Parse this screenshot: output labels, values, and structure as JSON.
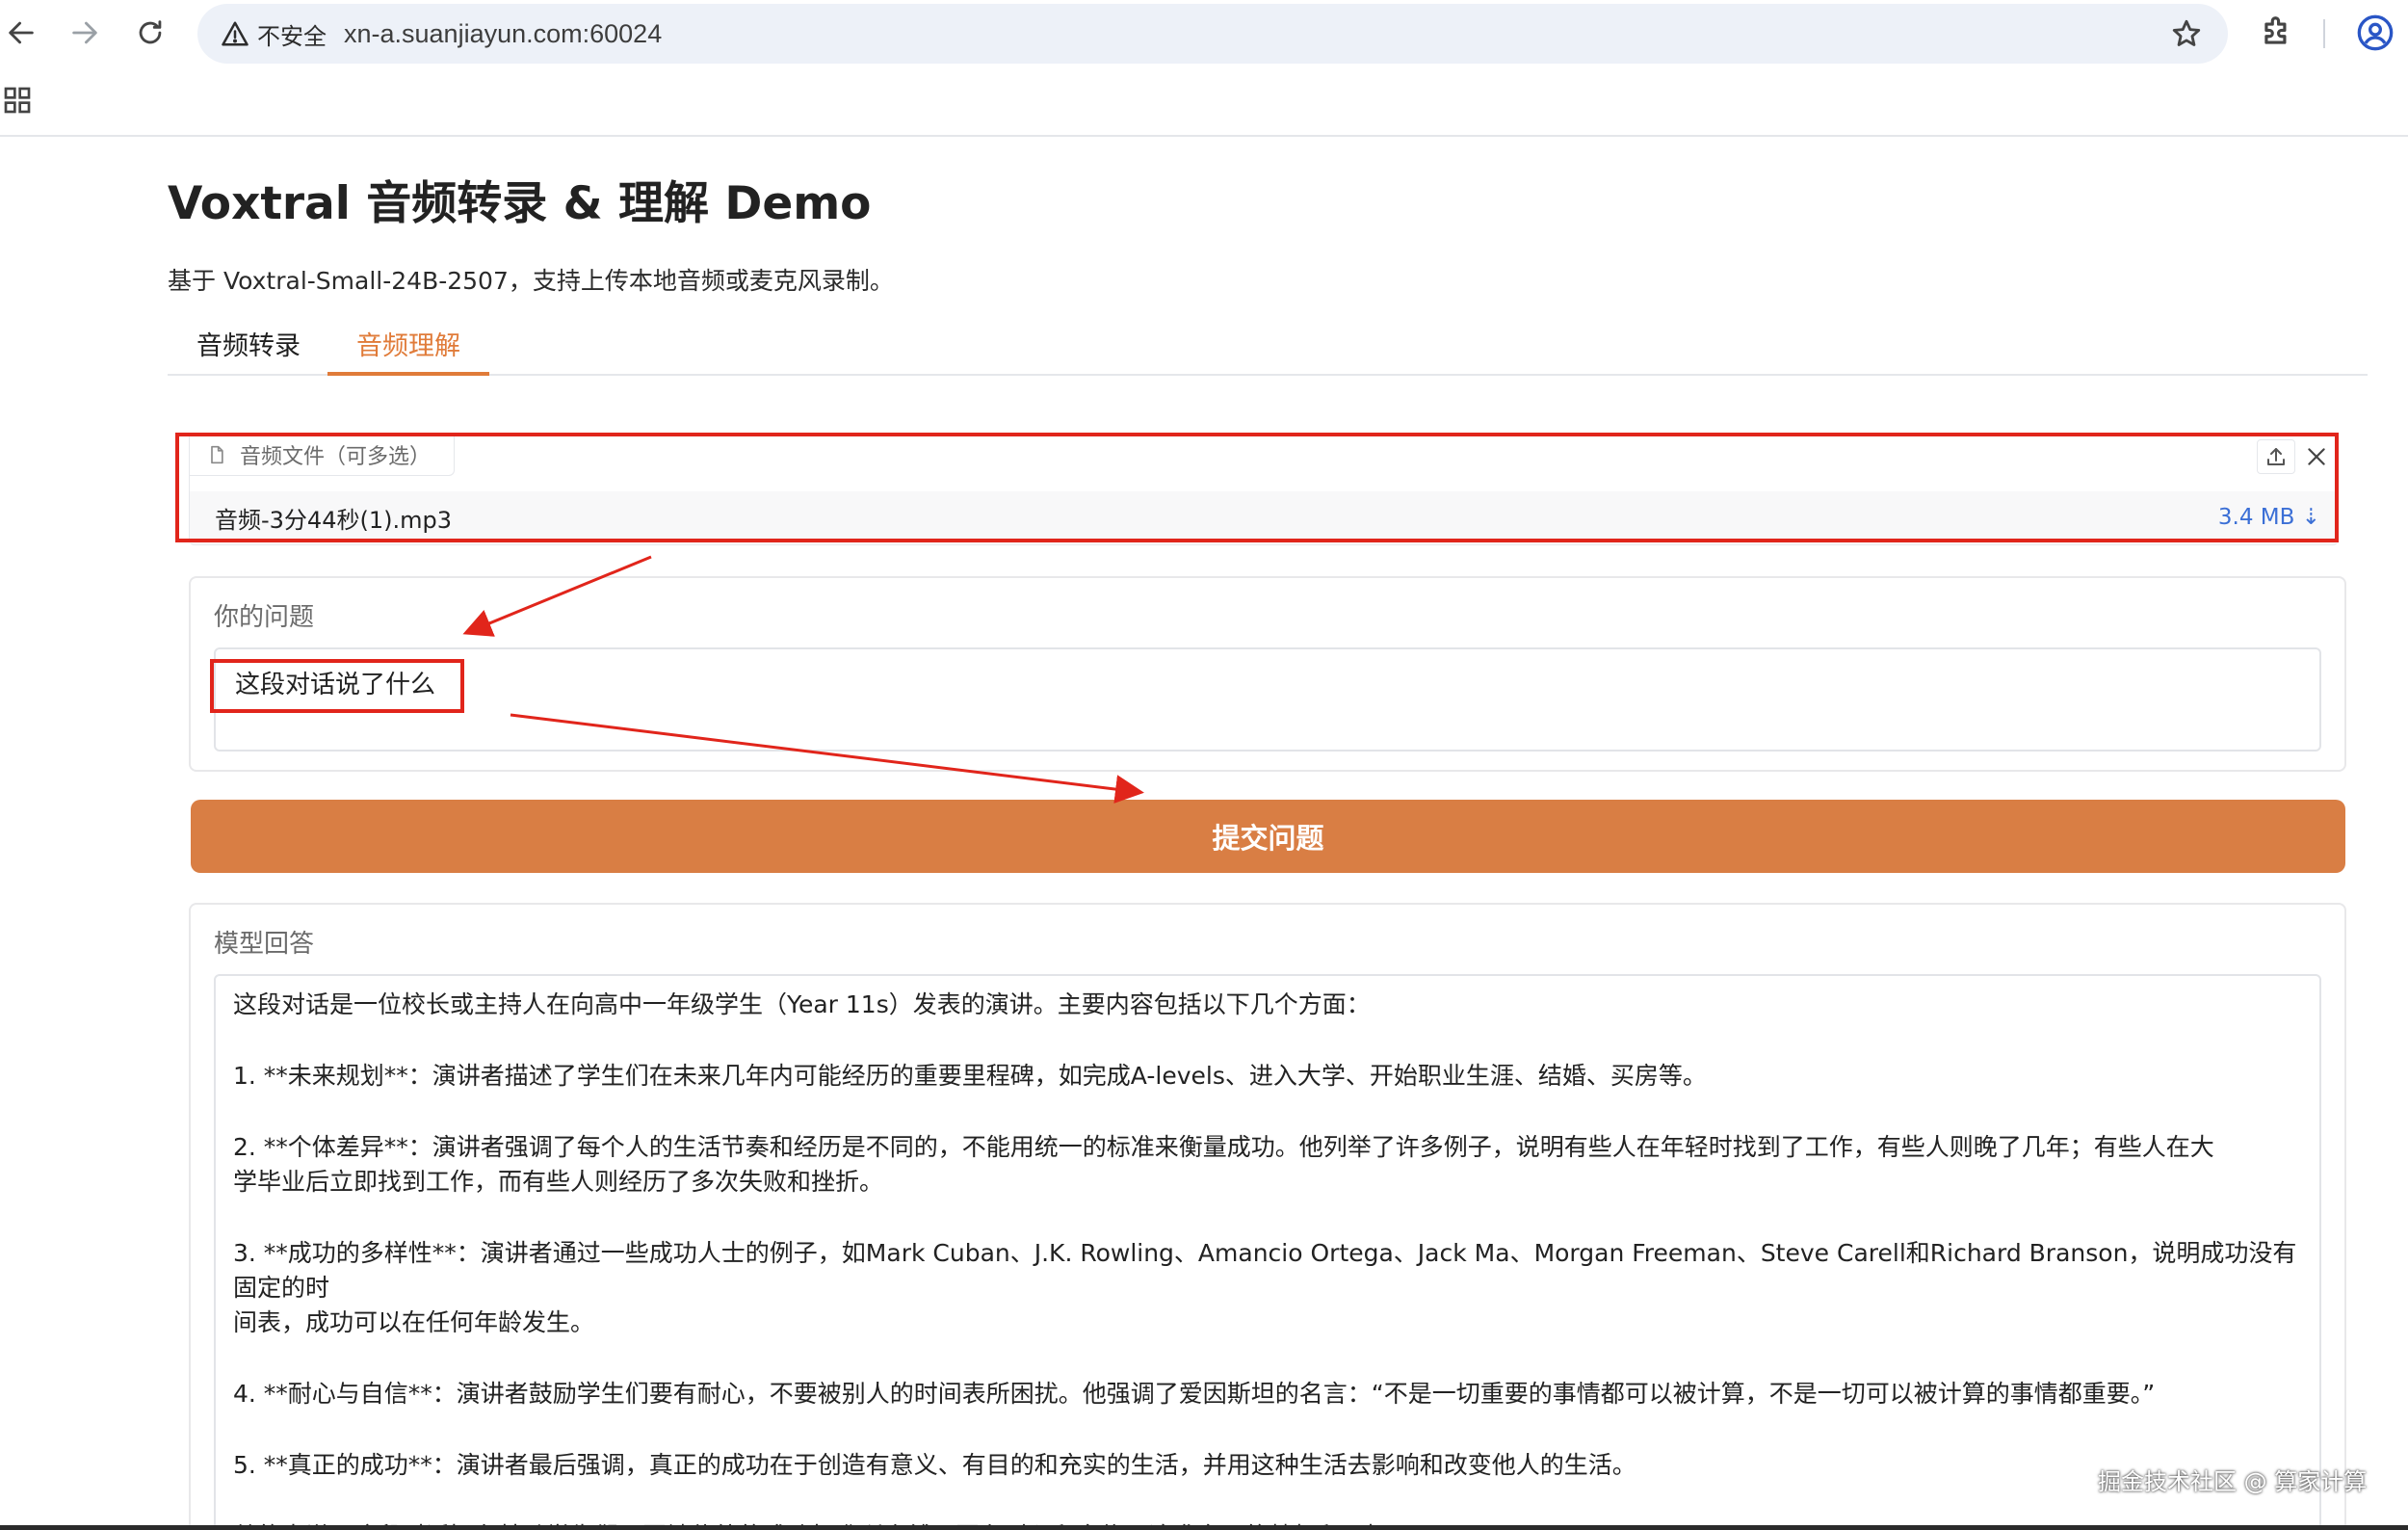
{
  "browser": {
    "security_label": "不安全",
    "url": "xn-a.suanjiayun.com:60024",
    "icons": [
      "back-icon",
      "forward-icon",
      "reload-icon",
      "warning-icon",
      "star-icon",
      "extensions-icon",
      "profile-icon",
      "apps-icon"
    ]
  },
  "page": {
    "title": "Voxtral 音频转录 & 理解 Demo",
    "description": "基于 Voxtral-Small-24B-2507，支持上传本地音频或麦克风录制。"
  },
  "tabs": [
    {
      "label": "音频转录",
      "active": false
    },
    {
      "label": "音频理解",
      "active": true
    }
  ],
  "file_upload": {
    "label": "音频文件（可多选）",
    "file_name": "音频-3分44秒(1).mp3",
    "file_size": "3.4 MB ⇣"
  },
  "question": {
    "label": "你的问题",
    "value": "这段对话说了什么"
  },
  "submit": {
    "label": "提交问题"
  },
  "response": {
    "label": "模型回答",
    "lines": [
      "这段对话是一位校长或主持人在向高中一年级学生（Year 11s）发表的演讲。主要内容包括以下几个方面：",
      "1. **未来规划**：演讲者描述了学生们在未来几年内可能经历的重要里程碑，如完成A-levels、进入大学、开始职业生涯、结婚、买房等。",
      "2. **个体差异**：演讲者强调了每个人的生活节奏和经历是不同的，不能用统一的标准来衡量成功。他列举了许多例子，说明有些人在年轻时找到了工作，有些人则晚了几年；有些人在大",
      "学毕业后立即找到工作，而有些人则经历了多次失败和挫折。",
      "3. **成功的多样性**：演讲者通过一些成功人士的例子，如Mark Cuban、J.K. Rowling、Amancio Ortega、Jack Ma、Morgan Freeman、Steve Carell和Richard Branson，说明成功没有固定的时",
      "间表，成功可以在任何年龄发生。",
      "4. **耐心与自信**：演讲者鼓励学生们要有耐心，不要被别人的时间表所困扰。他强调了爱因斯坦的名言：“不是一切重要的事情都可以被计算，不是一切可以被计算的事情都重要。”",
      "5. **真正的成功**：演讲者最后强调，真正的成功在于创造有意义、有目的和充实的生活，并用这种生活去影响和改变他人的生活。",
      "总的来说，这段对话旨在鼓励学生们不要被传统的成功标准所束缚，要有耐心和自信，追求自己的梦想和目标。"
    ]
  },
  "watermark": "掘金技术社区 @ 算家计算",
  "colors": {
    "accent": "#d97e44",
    "active_tab": "#e07b39",
    "annotation": "#e1251b",
    "link": "#3b6fd6"
  }
}
